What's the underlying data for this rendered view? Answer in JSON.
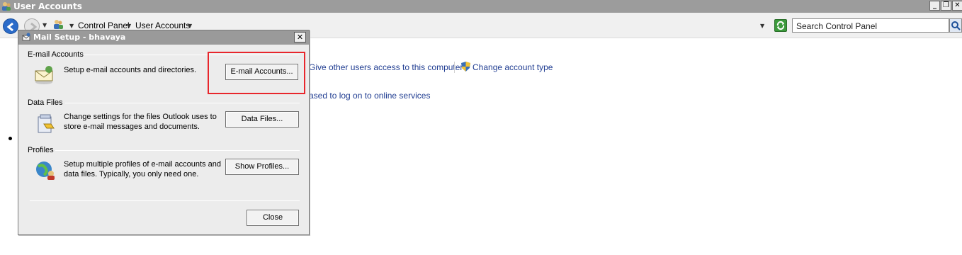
{
  "window": {
    "title": "User Accounts",
    "minimize": "_",
    "restore": "❐",
    "close": "✕"
  },
  "address": {
    "crumbs": [
      "Control Panel",
      "User Accounts"
    ],
    "search_placeholder": "Search Control Panel"
  },
  "background": {
    "link_give_access": "Give other users access to this computer",
    "link_change_type": "Change account type",
    "link_online": "ased to log on to online services"
  },
  "dialog": {
    "title": "Mail Setup - bhavaya",
    "close": "✕",
    "groups": [
      {
        "label": "E-mail Accounts",
        "desc": "Setup e-mail accounts and directories.",
        "button": "E-mail Accounts..."
      },
      {
        "label": "Data Files",
        "desc": "Change settings for the files Outlook uses to store e-mail messages and documents.",
        "button": "Data Files..."
      },
      {
        "label": "Profiles",
        "desc": "Setup multiple profiles of e-mail accounts and data files. Typically, you only need one.",
        "button": "Show Profiles..."
      }
    ],
    "close_button": "Close"
  },
  "colors": {
    "highlight": "#e8262c",
    "link": "#1f3c91",
    "titlebar": "#9c9c9c"
  },
  "icons": [
    "user-accounts-icon",
    "back-icon",
    "forward-icon",
    "refresh-icon",
    "search-icon",
    "shield-icon",
    "mail-icon",
    "data-files-icon",
    "profiles-icon"
  ]
}
